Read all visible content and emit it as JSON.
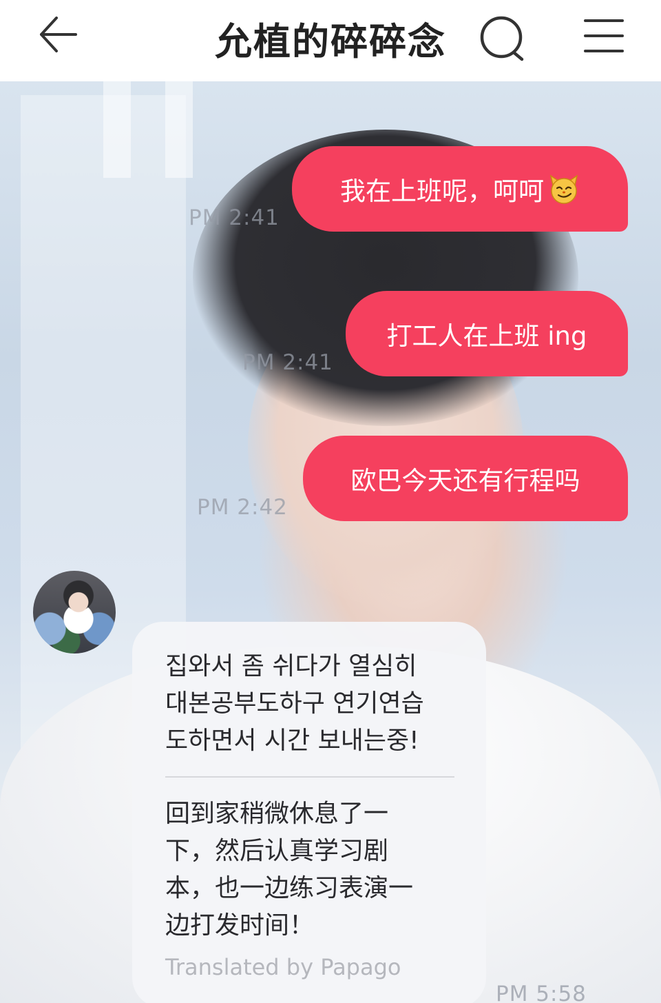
{
  "header": {
    "title": "允植的碎碎念"
  },
  "messages": {
    "sent": [
      {
        "text": "我在上班呢，呵呵",
        "emoji": "smirking-cat-emoji"
      },
      {
        "text": "打工人在上班 ing"
      },
      {
        "text": "欧巴今天还有行程吗"
      }
    ],
    "timestamps": [
      "PM 2:41",
      "PM 2:41",
      "PM 2:42",
      "PM 5:58"
    ],
    "received": {
      "original_lines": [
        "집와서 좀 쉬다가 열심히",
        "대본공부도하구 연기연습",
        "도하면서 시간 보내는중!"
      ],
      "translated_lines": [
        "回到家稍微休息了一",
        "下，然后认真学习剧",
        "本，也一边练习表演一",
        "边打发时间！"
      ],
      "translated_by": "Translated by Papago"
    }
  },
  "colors": {
    "accent": "#f5405e",
    "received_bubble": "#f4f5f8"
  }
}
